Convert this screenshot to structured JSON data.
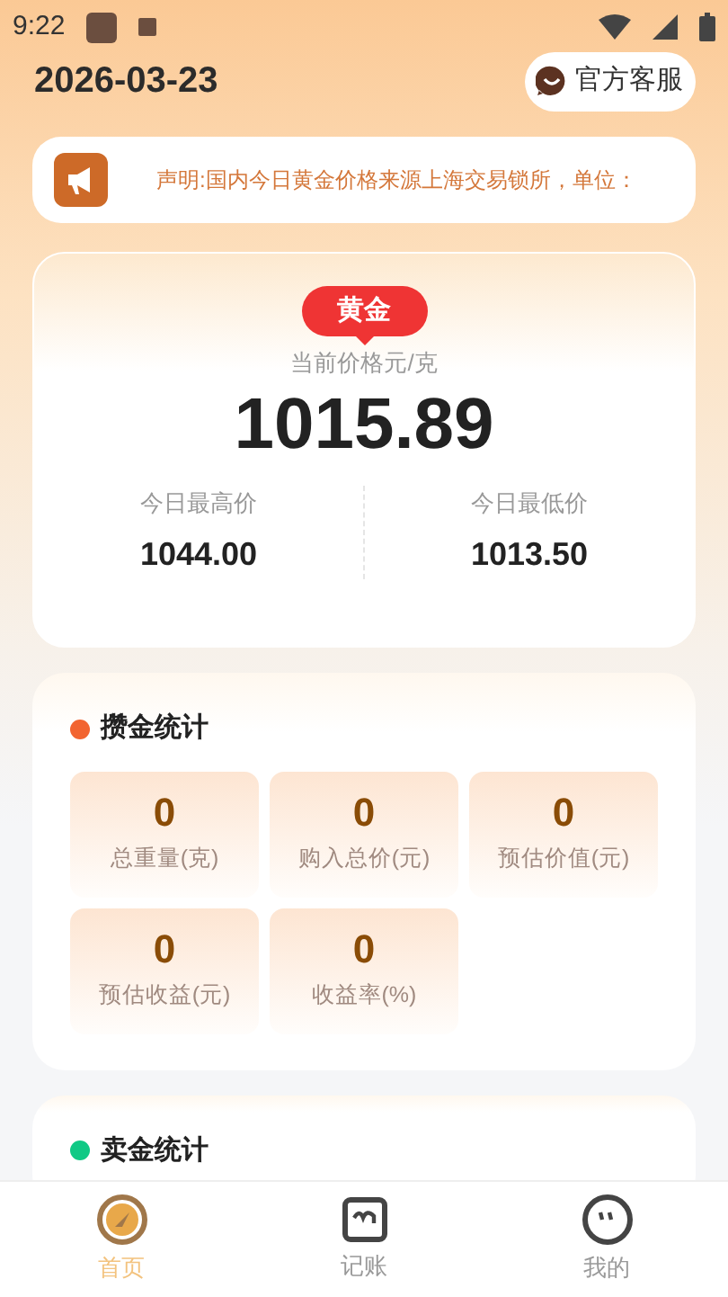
{
  "status_bar": {
    "time": "9:22"
  },
  "header": {
    "date": "2026-03-23",
    "service_button": "官方客服"
  },
  "notice": {
    "text": "声明:国内今日黄金价格来源上海交易锁所，单位："
  },
  "price_card": {
    "tag": "黄金",
    "label": "当前价格元/克",
    "price": "1015.89",
    "stats": [
      {
        "label": "今日最高价",
        "value": "1044.00"
      },
      {
        "label": "今日最低价",
        "value": "1013.50"
      }
    ]
  },
  "sections": [
    {
      "title": "攒金统计",
      "color": "#f26430",
      "tiles": [
        {
          "value": "0",
          "label": "总重量(克)"
        },
        {
          "value": "0",
          "label": "购入总价(元)"
        },
        {
          "value": "0",
          "label": "预估价值(元)"
        },
        {
          "value": "0",
          "label": "预估收益(元)"
        },
        {
          "value": "0",
          "label": "收益率(%)"
        }
      ]
    },
    {
      "title": "卖金统计",
      "color": "#10c985"
    }
  ],
  "tab_bar": [
    {
      "label": "首页",
      "kind": "home",
      "selected": true
    },
    {
      "label": "记账",
      "kind": "ledger",
      "selected": false
    },
    {
      "label": "我的",
      "kind": "profile",
      "selected": false
    }
  ]
}
